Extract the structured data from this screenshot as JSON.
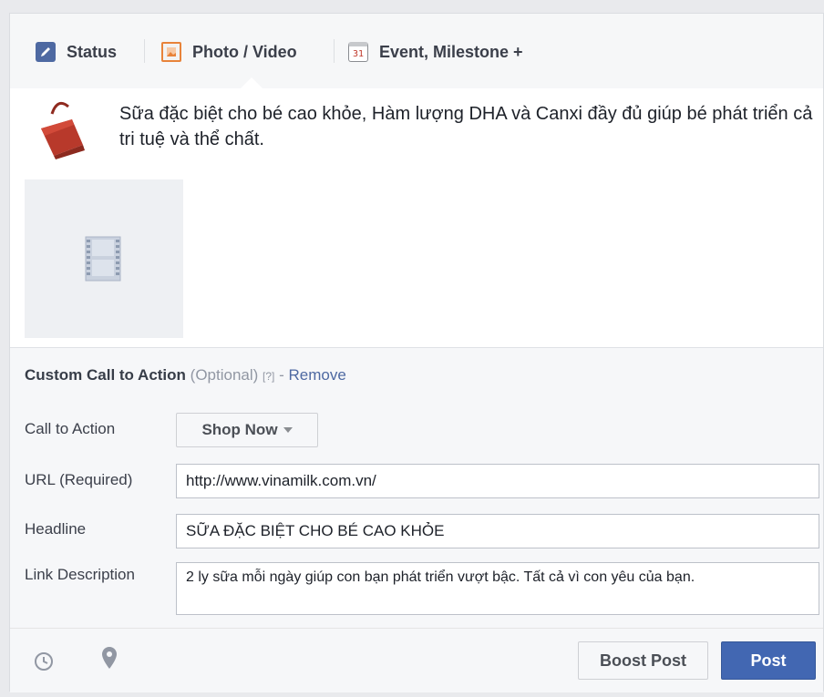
{
  "tabs": [
    {
      "label": "Status",
      "icon": "pencil-icon"
    },
    {
      "label": "Photo / Video",
      "icon": "photo-icon"
    },
    {
      "label": "Event, Milestone +",
      "icon": "calendar-icon",
      "icon_text": "31"
    }
  ],
  "post": {
    "message": "Sữa đặc biệt cho bé cao khỏe, Hàm lượng DHA và Canxi đầy đủ giúp bé phát triển cả tri tuệ và thể chất."
  },
  "cta": {
    "title": "Custom Call to Action",
    "optional": "(Optional)",
    "help": "[?]",
    "separator": "-",
    "remove": "Remove",
    "rows": {
      "call_to_action_label": "Call to Action",
      "call_to_action_value": "Shop Now",
      "url_label": "URL (Required)",
      "url_value": "http://www.vinamilk.com.vn/",
      "headline_label": "Headline",
      "headline_value": "SỮA ĐẶC BIỆT CHO BÉ CAO KHỎE",
      "description_label": "Link Description",
      "description_value": "2 ly sữa mỗi ngày giúp con bạn phát triển vượt bậc. Tất cả vì con yêu của bạn."
    }
  },
  "footer": {
    "boost_label": "Boost Post",
    "post_label": "Post"
  },
  "colors": {
    "brand_blue": "#4267b2",
    "link_blue": "#4e69a2",
    "photo_tab_orange": "#e8833a"
  }
}
